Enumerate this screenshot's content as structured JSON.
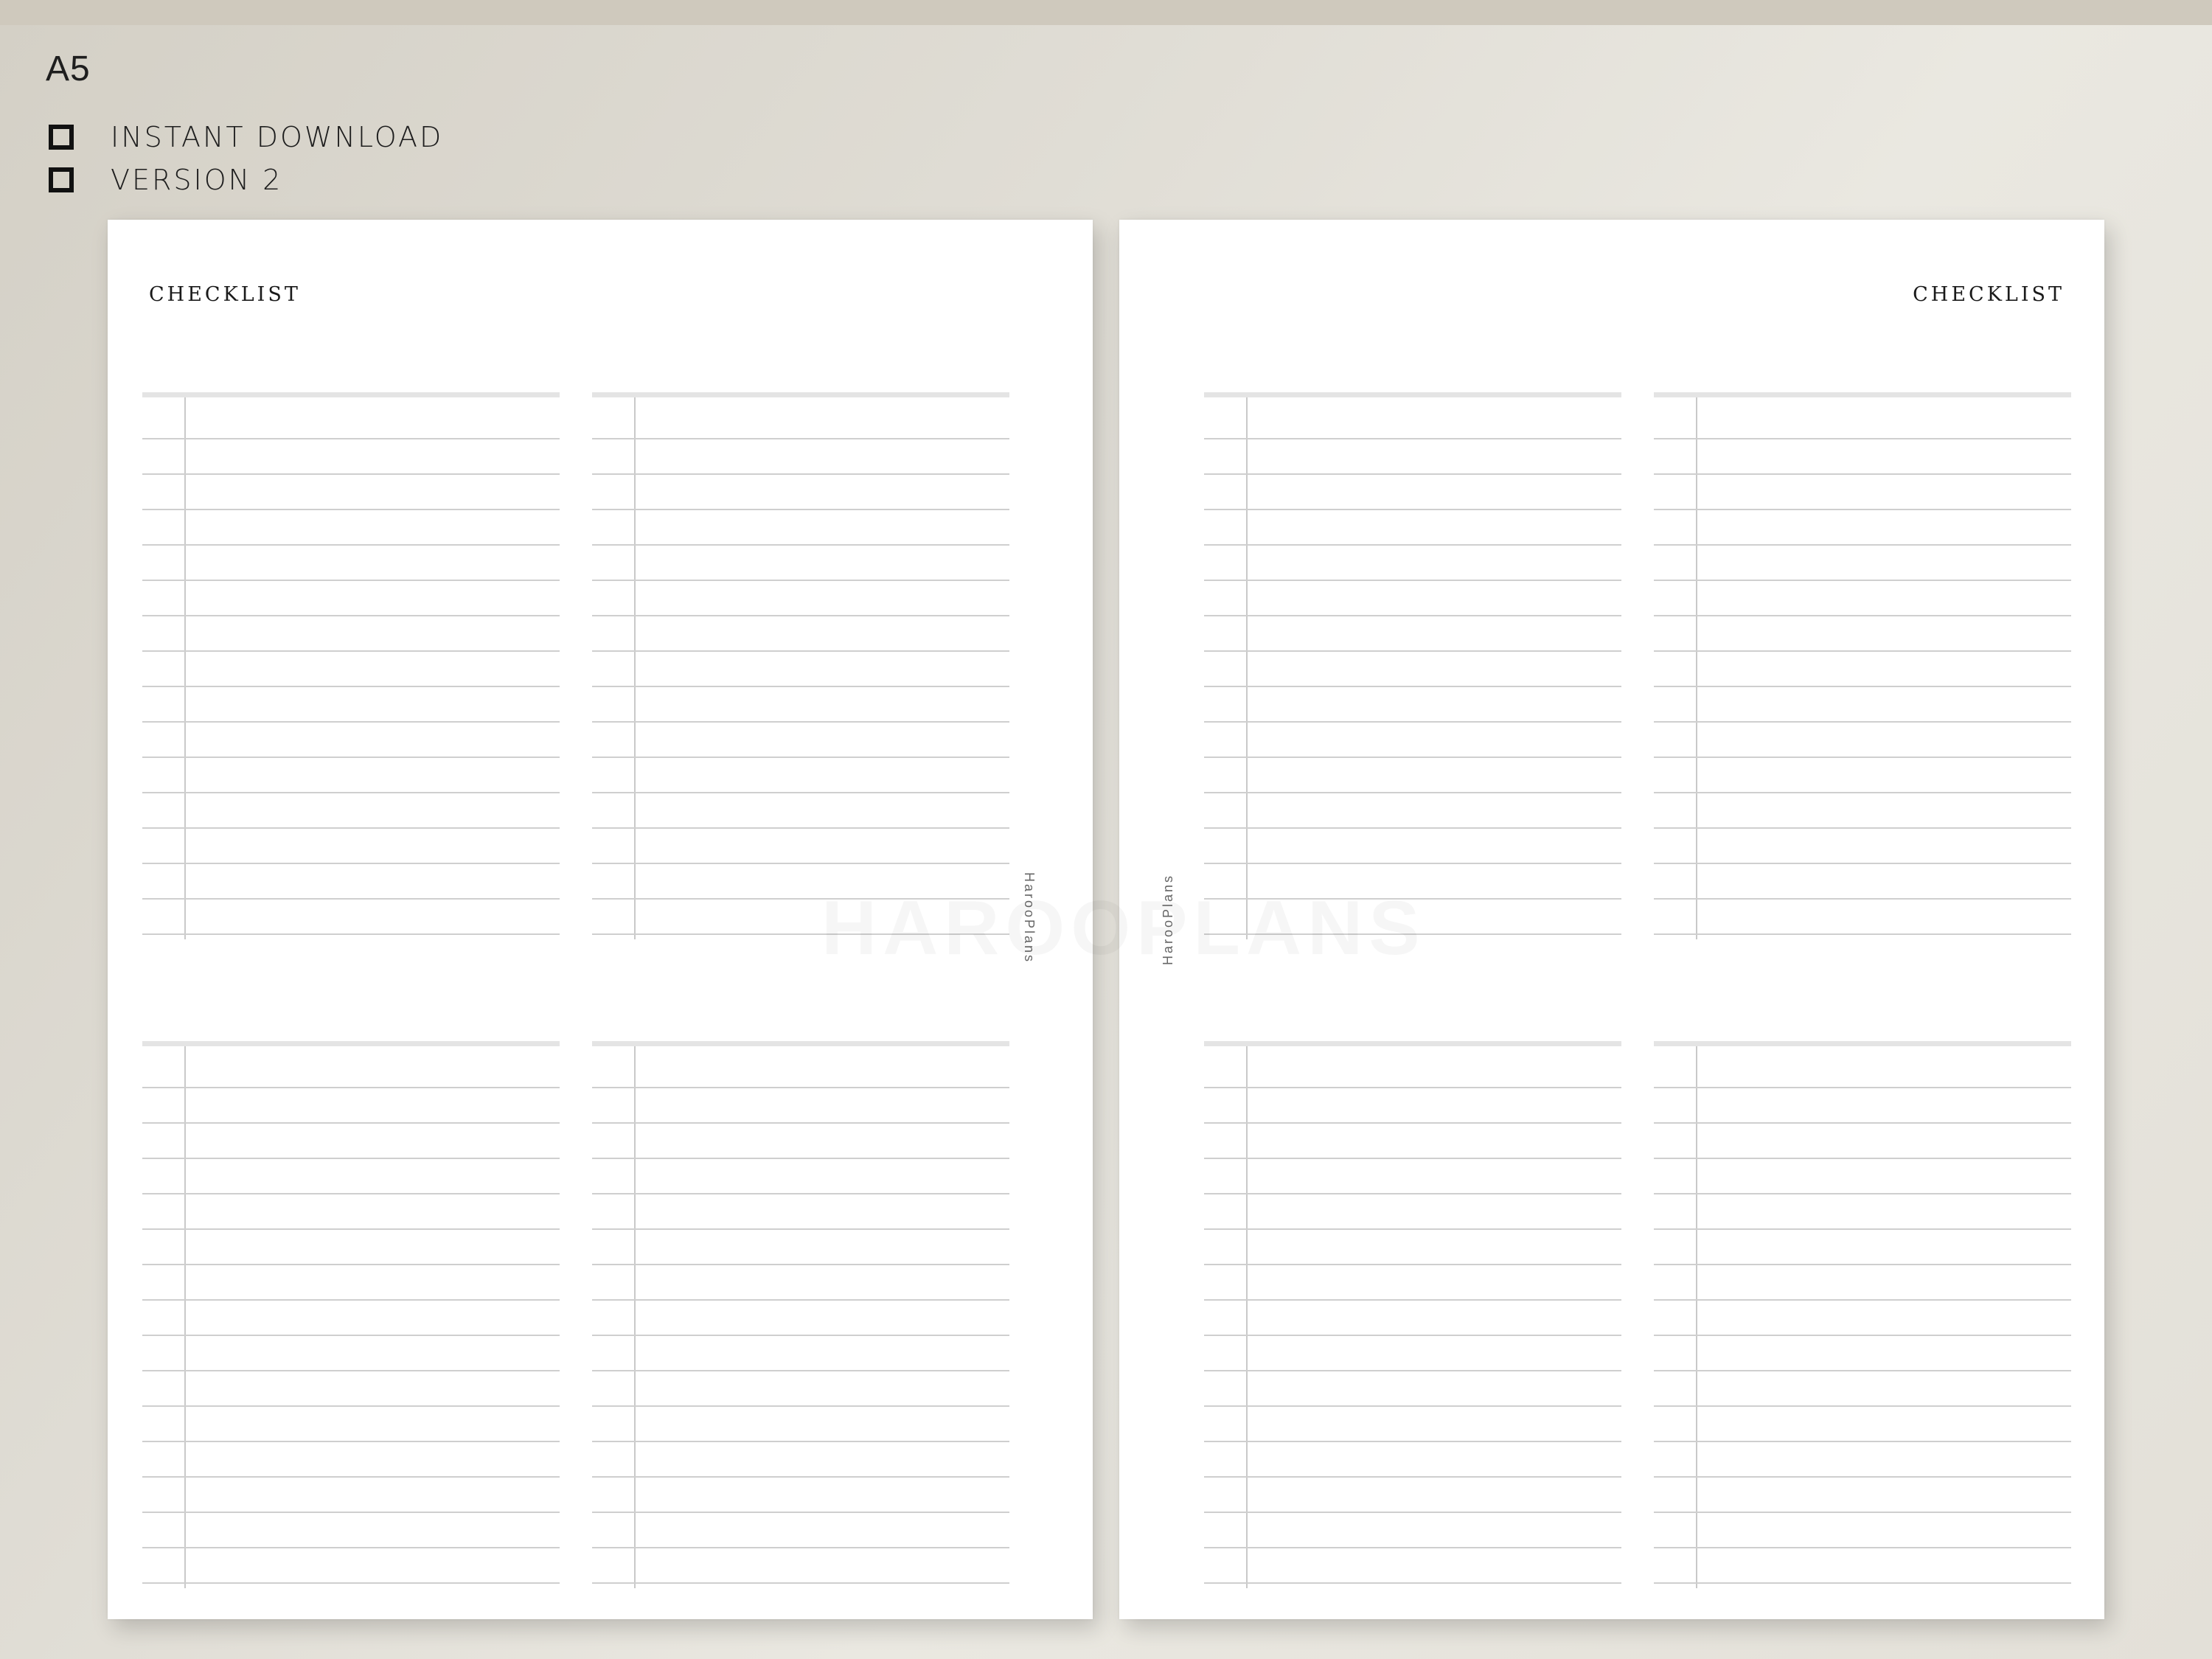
{
  "header": {
    "size_label": "A5",
    "features": [
      {
        "label": "INSTANT DOWNLOAD"
      },
      {
        "label": "VERSION 2"
      }
    ]
  },
  "pages": [
    {
      "title": "CHECKLIST",
      "brand": "HarooPlans"
    },
    {
      "title": "CHECKLIST",
      "brand": "HarooPlans"
    }
  ],
  "checklist": {
    "rows_per_block": 15,
    "blocks_per_page": 4
  },
  "watermark": "HAROOPLANS",
  "colors": {
    "page": "#ffffff",
    "rule": "#cfcfcf",
    "header_bar": "#e4e4e4",
    "text": "#1a1a1a"
  }
}
